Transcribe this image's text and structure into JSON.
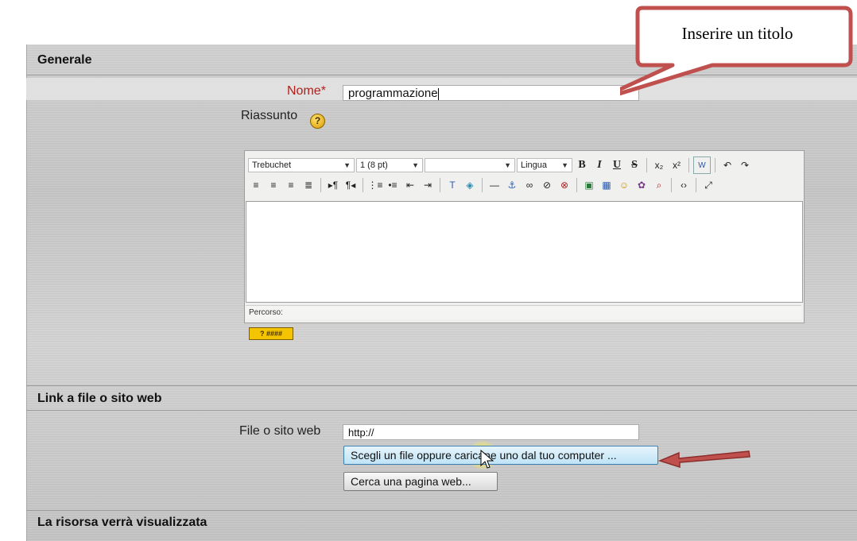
{
  "callout": {
    "text": "Inserire un titolo"
  },
  "sections": {
    "general": "Generale",
    "link": "Link a file o sito web",
    "display": "La risorsa verrà visualizzata"
  },
  "fields": {
    "name_label": "Nome",
    "name_required": "*",
    "name_value": "programmazione",
    "summary_label": "Riassunto",
    "summary_help": "?",
    "url_label": "File o sito web",
    "url_value": "http://"
  },
  "editor": {
    "font": "Trebuchet",
    "size": "1 (8 pt)",
    "style": "",
    "lang": "Lingua",
    "status_label": "Percorso:",
    "kbd_help": "? ####"
  },
  "buttons": {
    "choose_file": "Scegli un file oppure caricane uno dal tuo computer ...",
    "search_web": "Cerca una pagina web..."
  },
  "colors": {
    "required": "#b0201a",
    "callout_fill": "#ffffff",
    "callout_border": "#c0504d",
    "arrow": "#c0504d"
  }
}
